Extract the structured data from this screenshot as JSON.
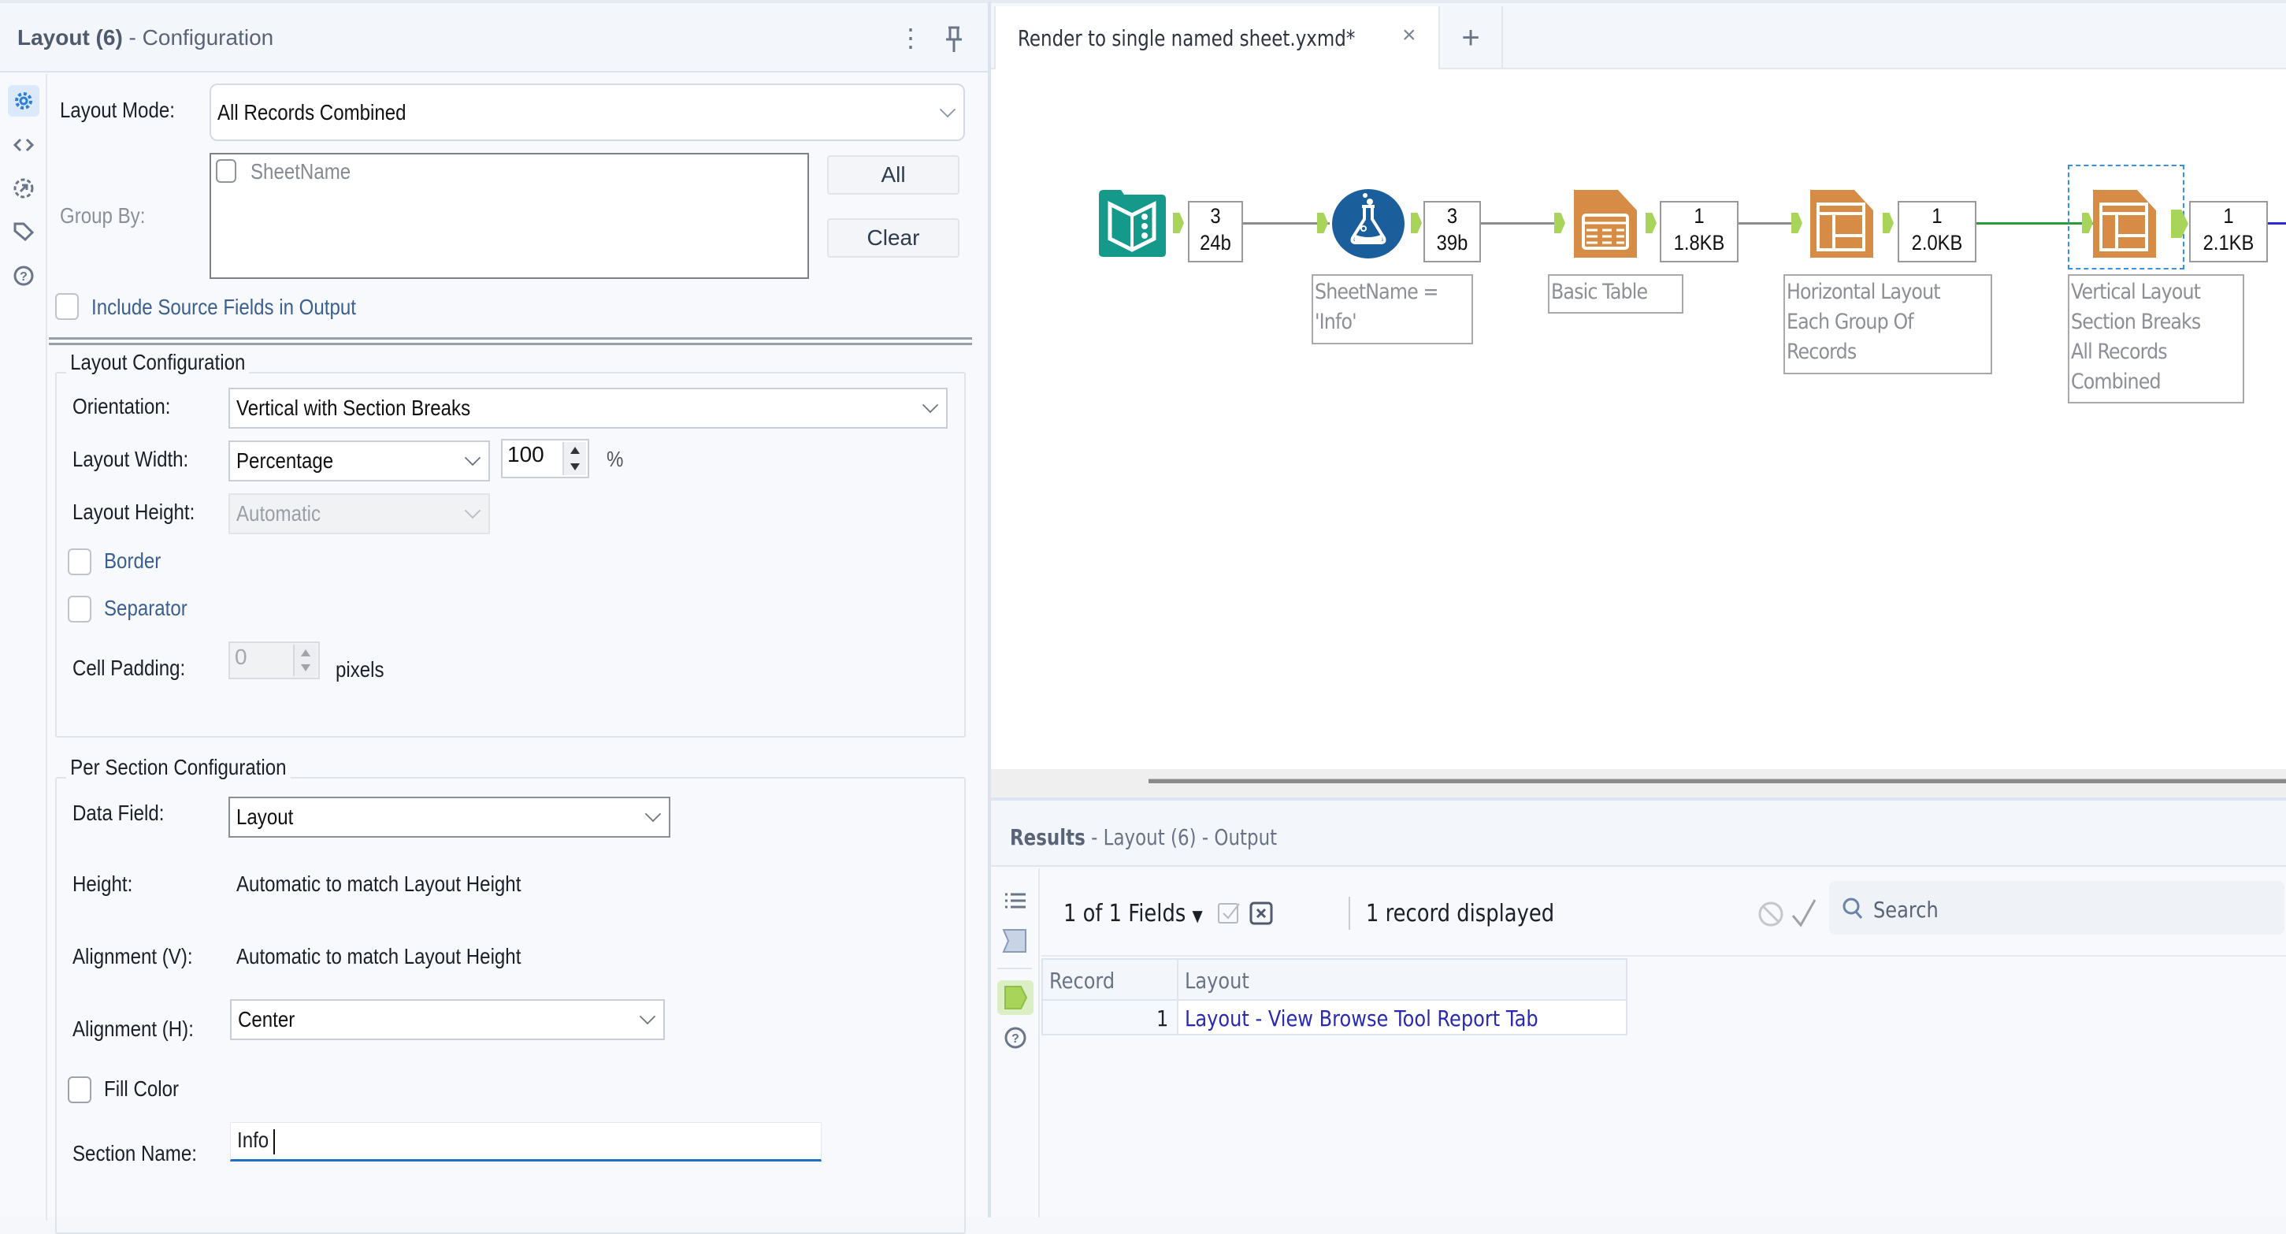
{
  "config_panel": {
    "title_tool": "Layout (6)",
    "title_suffix": " - Configuration",
    "rail_icons": [
      "gear-icon",
      "code-icon",
      "connection-icon",
      "tag-icon",
      "help-icon"
    ],
    "layout_mode": {
      "label": "Layout Mode:",
      "value": "All Records Combined"
    },
    "group_by": {
      "label": "Group By:",
      "fields": [
        {
          "name": "SheetName",
          "checked": false
        }
      ],
      "all_button": "All",
      "clear_button": "Clear"
    },
    "include_source": {
      "label": "Include Source Fields in Output",
      "checked": false
    },
    "layout_configuration": {
      "legend": "Layout Configuration",
      "orientation": {
        "label": "Orientation:",
        "value": "Vertical with Section Breaks"
      },
      "layout_width": {
        "label": "Layout Width:",
        "mode": "Percentage",
        "value": "100",
        "unit": "%"
      },
      "layout_height": {
        "label": "Layout Height:",
        "value": "Automatic"
      },
      "border": {
        "label": "Border",
        "checked": false
      },
      "separator": {
        "label": "Separator",
        "checked": false
      },
      "cell_padding": {
        "label": "Cell Padding:",
        "value": "0",
        "unit": "pixels"
      }
    },
    "per_section": {
      "legend": "Per Section Configuration",
      "data_field": {
        "label": "Data Field:",
        "value": "Layout"
      },
      "height": {
        "label": "Height:",
        "value": "Automatic to match Layout Height"
      },
      "alignment_v": {
        "label": "Alignment (V):",
        "value": "Automatic to match Layout Height"
      },
      "alignment_h": {
        "label": "Alignment (H):",
        "value": "Center"
      },
      "fill_color": {
        "label": "Fill Color",
        "checked": false
      },
      "section_name": {
        "label": "Section Name:",
        "value": "Info"
      }
    }
  },
  "tabs": {
    "active": "Render to single named sheet.yxmd*",
    "close": "×",
    "new": "+"
  },
  "workflow": {
    "nodes": [
      {
        "tool": "Text Input",
        "icon": "book-icon",
        "color": "#14998a",
        "count": "3",
        "size": "24b",
        "label": ""
      },
      {
        "tool": "Formula",
        "icon": "flask-icon",
        "color": "#1a5f9c",
        "count": "3",
        "size": "39b",
        "label": "SheetName =\n'Info'"
      },
      {
        "tool": "Basic Table",
        "icon": "table-icon",
        "color": "#d68c45",
        "count": "1",
        "size": "1.8KB",
        "label": "Basic Table"
      },
      {
        "tool": "Layout",
        "icon": "layout-icon",
        "color": "#d68c45",
        "count": "1",
        "size": "2.0KB",
        "label": "Horizontal Layout\nEach Group Of\nRecords"
      },
      {
        "tool": "Layout",
        "icon": "layout-icon",
        "color": "#d68c45",
        "count": "1",
        "size": "2.1KB",
        "label": "Vertical Layout\nSection Breaks\nAll Records\nCombined",
        "selected": true
      }
    ],
    "connection_colors": [
      "#8c8c8c",
      "#8c8c8c",
      "#8c8c8c",
      "#2a9d3a",
      "#2b2bdc"
    ]
  },
  "results": {
    "title_bold": "Results",
    "title_rest": " - Layout (6) - Output",
    "fields_label": "1 of 1 Fields",
    "records_label": "1 record displayed",
    "search_placeholder": "Search",
    "columns": [
      "Record",
      "Layout"
    ],
    "rows": [
      [
        "1",
        "Layout - View Browse Tool Report Tab"
      ]
    ]
  }
}
